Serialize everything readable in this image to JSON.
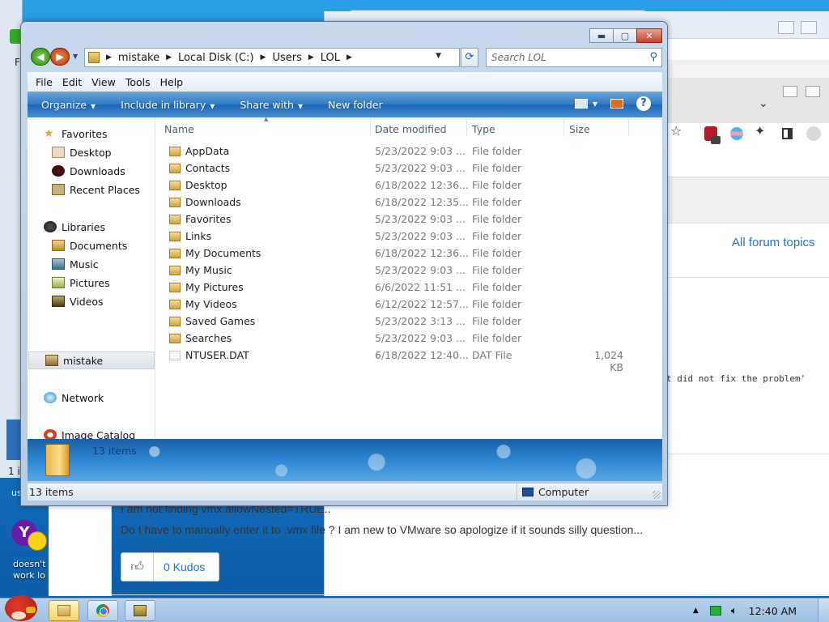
{
  "explorer": {
    "address": {
      "crumbs": [
        "mistake",
        "Local Disk (C:)",
        "Users",
        "LOL"
      ]
    },
    "search_placeholder": "Search LOL",
    "menu": [
      "File",
      "Edit",
      "View",
      "Tools",
      "Help"
    ],
    "commands": {
      "organize": "Organize",
      "include_in_library": "Include in library",
      "share_with": "Share with",
      "new_folder": "New folder"
    },
    "nav": {
      "favorites": "Favorites",
      "favorites_items": [
        "Desktop",
        "Downloads",
        "Recent Places"
      ],
      "libraries": "Libraries",
      "libraries_items": [
        "Documents",
        "Music",
        "Pictures",
        "Videos"
      ],
      "user": "mistake",
      "network": "Network",
      "image_catalog": "Image Catalog"
    },
    "columns": {
      "name": "Name",
      "date_modified": "Date modified",
      "type": "Type",
      "size": "Size"
    },
    "files": [
      {
        "name": "AppData",
        "date": "5/23/2022 9:03 ...",
        "type": "File folder",
        "size": ""
      },
      {
        "name": "Contacts",
        "date": "5/23/2022 9:03 ...",
        "type": "File folder",
        "size": ""
      },
      {
        "name": "Desktop",
        "date": "6/18/2022 12:36...",
        "type": "File folder",
        "size": ""
      },
      {
        "name": "Downloads",
        "date": "6/18/2022 12:35...",
        "type": "File folder",
        "size": ""
      },
      {
        "name": "Favorites",
        "date": "5/23/2022 9:03 ...",
        "type": "File folder",
        "size": ""
      },
      {
        "name": "Links",
        "date": "5/23/2022 9:03 ...",
        "type": "File folder",
        "size": ""
      },
      {
        "name": "My Documents",
        "date": "6/18/2022 12:36...",
        "type": "File folder",
        "size": ""
      },
      {
        "name": "My Music",
        "date": "5/23/2022 9:03 ...",
        "type": "File folder",
        "size": ""
      },
      {
        "name": "My Pictures",
        "date": "6/6/2022 11:51 ...",
        "type": "File folder",
        "size": ""
      },
      {
        "name": "My Videos",
        "date": "6/12/2022 12:57...",
        "type": "File folder",
        "size": ""
      },
      {
        "name": "Saved Games",
        "date": "5/23/2022 3:13 ...",
        "type": "File folder",
        "size": ""
      },
      {
        "name": "Searches",
        "date": "5/23/2022 9:03 ...",
        "type": "File folder",
        "size": ""
      },
      {
        "name": "NTUSER.DAT",
        "date": "6/18/2022 12:40...",
        "type": "DAT File",
        "size": "1,024 KB"
      }
    ],
    "details_count": "13 items",
    "status_count": "13 items",
    "status_location": "Computer"
  },
  "browser": {
    "forum_link": "All forum topics",
    "mono_snippet": "t did not fix the problem'",
    "post_line1": "I am not finding vmx.allowNested=TRUE..",
    "post_line2": "Do I have to manually enter it to .vmx file ? I am new to VMware so apologize if it sounds silly question...",
    "kudos": "0 Kudos",
    "extension_badge": "5"
  },
  "desktop": {
    "left_edge_f": "F",
    "left_edge_items": "1 i",
    "left_edge_us": "us",
    "yahoo_label_1": "doesn't",
    "yahoo_label_2": "work lo"
  },
  "taskbar": {
    "clock": "12:40 AM"
  }
}
